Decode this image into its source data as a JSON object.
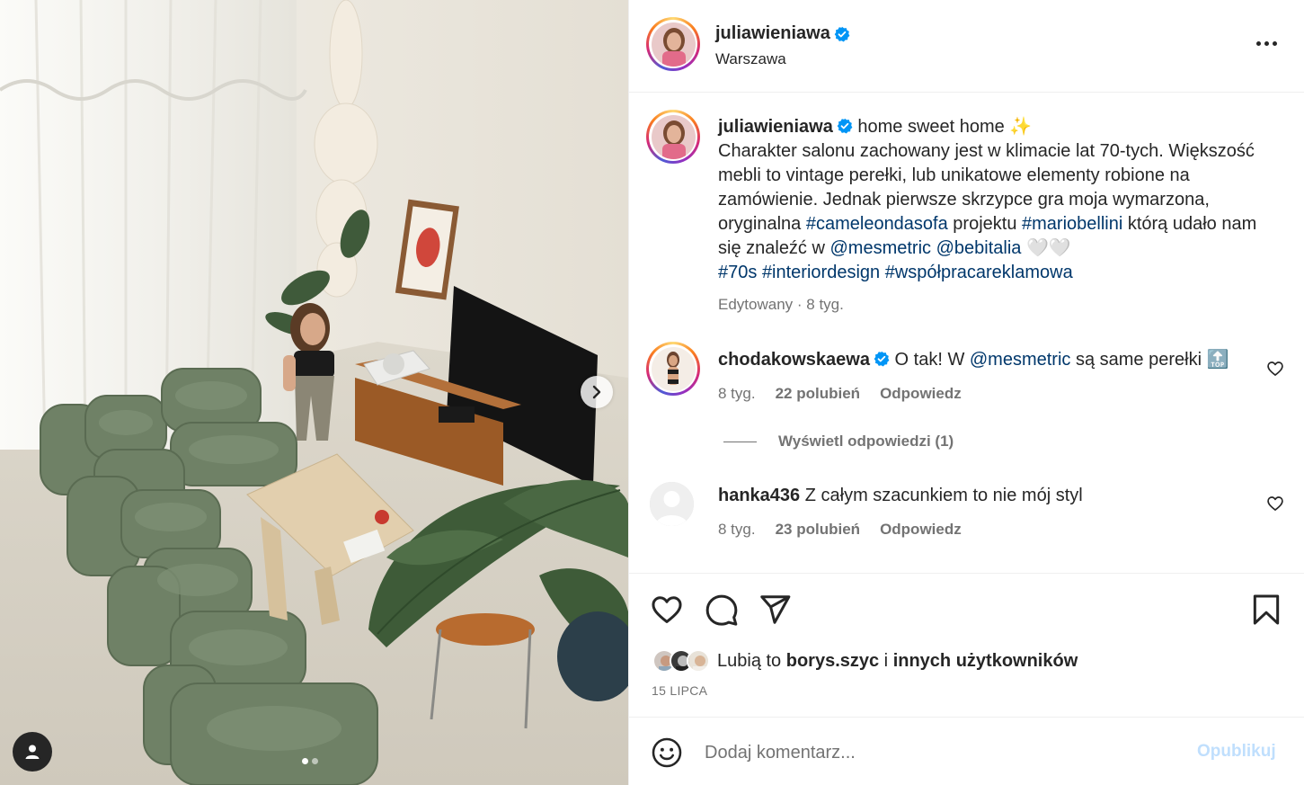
{
  "post": {
    "author": "juliawieniawa",
    "location": "Warszawa",
    "verified": true
  },
  "caption": {
    "username": "juliawieniawa",
    "text_1": "home sweet home ✨",
    "text_2": "Charakter salonu zachowany jest w klimacie lat 70-tych. Większość mebli to vintage perełki, lub unikatowe elementy robione na zamówienie. Jednak pierwsze skrzypce gra moja wymarzona, oryginalna ",
    "tag_1": "#cameleondasofa",
    "text_3": " projektu ",
    "tag_2": "#mariobellini",
    "text_4": " którą udało nam się znaleźć w ",
    "tag_3": "@mesmetric",
    "text_5": " ",
    "tag_4": "@bebitalia",
    "text_6": " 🤍🤍",
    "tag_5": "#70s",
    "tag_6": "#interiordesign",
    "tag_7": "#współpracareklamowa",
    "meta": "Edytowany · 8 tyg."
  },
  "comments": [
    {
      "username": "chodakowskaewa",
      "verified": true,
      "text_pre": "O tak! W ",
      "mention": "@mesmetric",
      "text_post": " są same perełki 🔝",
      "time": "8 tyg.",
      "likes": "22 polubień",
      "reply": "Odpowiedz",
      "view_replies": "Wyświetl odpowiedzi (1)"
    },
    {
      "username": "hanka436",
      "text": "Z całym szacunkiem to nie mój styl",
      "time": "8 tyg.",
      "likes": "23 polubień",
      "reply": "Odpowiedz"
    }
  ],
  "likes": {
    "prefix": "Lubią to ",
    "user": "borys.szyc",
    "middle": " i ",
    "others": "innych użytkowników"
  },
  "date": "15 LIPCA",
  "add_comment": {
    "placeholder": "Dodaj komentarz...",
    "publish": "Opublikuj"
  },
  "carousel": {
    "total": 2,
    "current": 1
  },
  "colors": {
    "link": "#00376b",
    "muted": "#737373",
    "verified": "#0095f6",
    "publish_disabled": "#c0dffd"
  }
}
